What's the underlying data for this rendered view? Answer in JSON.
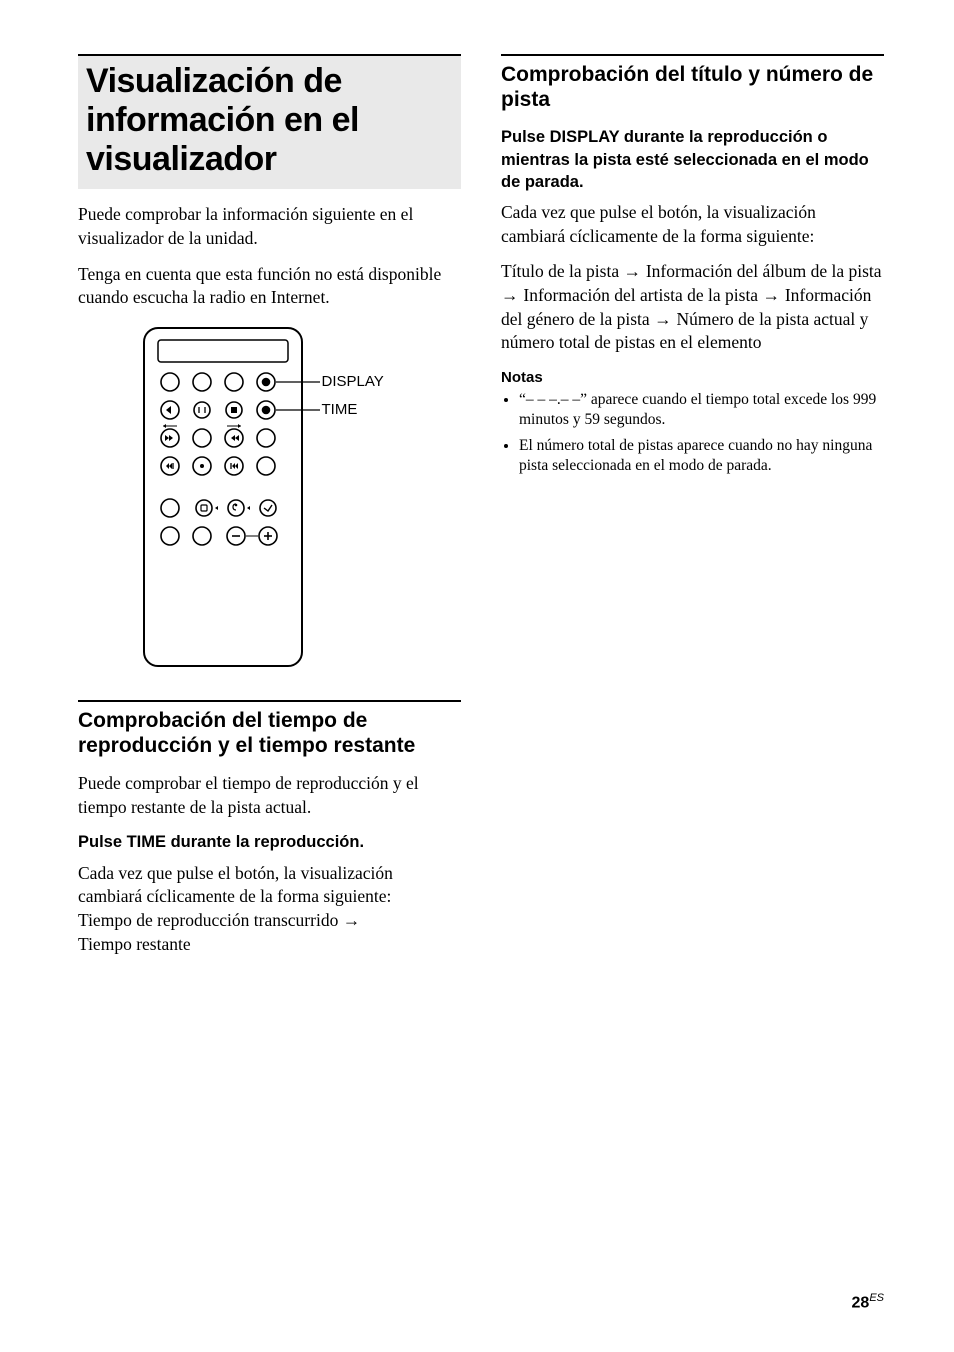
{
  "left": {
    "title": "Visualización de información en el visualizador",
    "intro1": "Puede comprobar la información siguiente en el visualizador de la unidad.",
    "intro2": "Tenga en cuenta que esta función no está disponible cuando escucha la radio en Internet.",
    "diagram": {
      "label_display": "DISPLAY",
      "label_time": "TIME"
    },
    "section1": {
      "heading": "Comprobación del tiempo de reproducción y el tiempo restante",
      "p1": "Puede comprobar el tiempo de reproducción y el tiempo restante de la pista actual.",
      "instruction": "Pulse TIME durante la reproducción.",
      "p2_prefix": "Cada vez que pulse el botón, la visualización cambiará cíclicamente de la forma siguiente:",
      "cycle_a": "Tiempo de reproducción transcurrido",
      "cycle_b": "Tiempo restante"
    }
  },
  "right": {
    "section2": {
      "heading": "Comprobación del título y número de pista",
      "instruction": "Pulse DISPLAY durante la reproducción o mientras la pista esté seleccionada en el modo de parada.",
      "p1": "Cada vez que pulse el botón, la visualización cambiará cíclicamente de la forma siguiente:",
      "cycle": {
        "a": "Título de la pista",
        "b": "Información del álbum de la pista",
        "c": "Información del artista de la pista",
        "d": "Información del género de la pista",
        "e": "Número de la pista actual y número total de pistas en el elemento"
      },
      "notes_heading": "Notas",
      "note1": "“– – –.– –” aparece cuando el tiempo total excede los 999 minutos y 59 segundos.",
      "note2": "El número total de pistas aparece cuando no hay ninguna pista seleccionada en el modo de parada."
    }
  },
  "page_number": "28",
  "page_region": "ES"
}
